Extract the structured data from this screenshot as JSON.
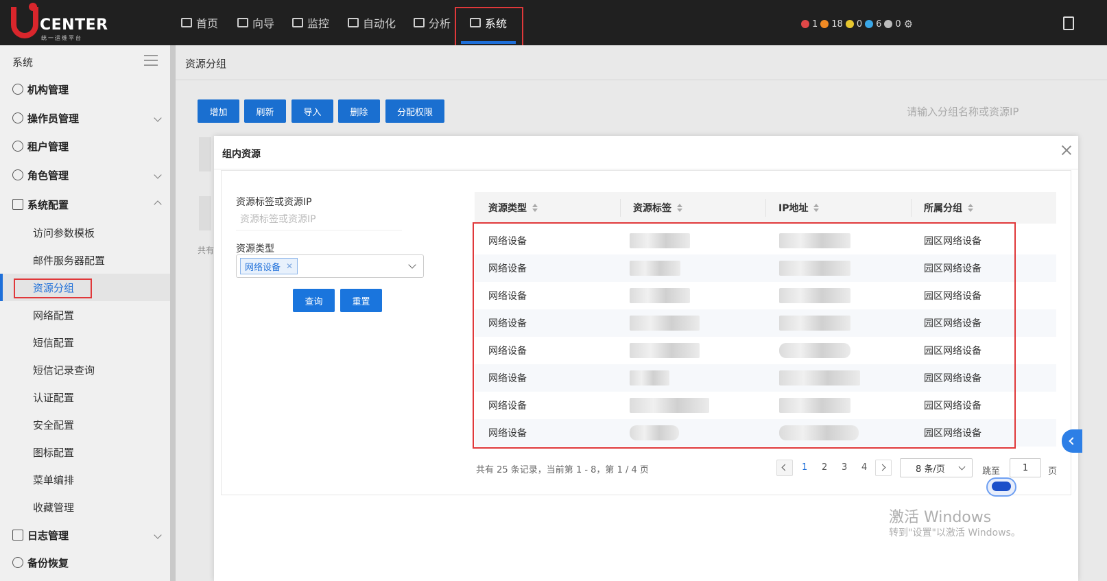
{
  "app": {
    "logo_title": "CENTER",
    "logo_sub": "统一运维平台"
  },
  "topnav": {
    "items": [
      {
        "label": "首页",
        "icon": "home-icon"
      },
      {
        "label": "向导",
        "icon": "guide-icon"
      },
      {
        "label": "监控",
        "icon": "monitor-icon"
      },
      {
        "label": "自动化",
        "icon": "automation-icon"
      },
      {
        "label": "分析",
        "icon": "analysis-icon"
      },
      {
        "label": "系统",
        "icon": "system-icon"
      }
    ],
    "active_index": 5,
    "alerts": [
      {
        "count": "1",
        "color": "#e04848"
      },
      {
        "count": "18",
        "color": "#f08a24"
      },
      {
        "count": "0",
        "color": "#e6c62f"
      },
      {
        "count": "6",
        "color": "#3aa7e8"
      },
      {
        "count": "0",
        "color": "#bbbbbb"
      }
    ]
  },
  "sidebar": {
    "title": "系统",
    "groups": [
      {
        "label": "机构管理",
        "icon": "org-icon",
        "chevron": "none"
      },
      {
        "label": "操作员管理",
        "icon": "operator-icon",
        "chevron": "down"
      },
      {
        "label": "租户管理",
        "icon": "tenant-icon",
        "chevron": "none"
      },
      {
        "label": "角色管理",
        "icon": "role-icon",
        "chevron": "down"
      },
      {
        "label": "系统配置",
        "icon": "config-icon",
        "chevron": "up"
      }
    ],
    "sub_items": [
      "访问参数模板",
      "邮件服务器配置",
      "资源分组",
      "网络配置",
      "短信配置",
      "短信记录查询",
      "认证配置",
      "安全配置",
      "图标配置",
      "菜单编排",
      "收藏管理"
    ],
    "active_sub": "资源分组",
    "bottom_groups": [
      {
        "label": "日志管理",
        "icon": "log-icon",
        "chevron": "down"
      },
      {
        "label": "备份恢复",
        "icon": "backup-icon",
        "chevron": "none"
      }
    ]
  },
  "main": {
    "title": "资源分组",
    "buttons": [
      "增加",
      "刷新",
      "导入",
      "删除",
      "分配权限"
    ],
    "search_placeholder": "请输入分组名称或资源IP",
    "total_partial": "共有"
  },
  "modal": {
    "title": "组内资源",
    "filter": {
      "label1": "资源标签或资源IP",
      "placeholder1": "资源标签或资源IP",
      "label2": "资源类型",
      "selected_tag": "网络设备",
      "query_label": "查询",
      "reset_label": "重置"
    },
    "table": {
      "columns": [
        "资源类型",
        "资源标签",
        "IP地址",
        "所属分组"
      ],
      "rows": [
        {
          "type": "网络设备",
          "group": "园区网络设备"
        },
        {
          "type": "网络设备",
          "group": "园区网络设备"
        },
        {
          "type": "网络设备",
          "group": "园区网络设备"
        },
        {
          "type": "网络设备",
          "group": "园区网络设备"
        },
        {
          "type": "网络设备",
          "group": "园区网络设备"
        },
        {
          "type": "网络设备",
          "group": "园区网络设备"
        },
        {
          "type": "网络设备",
          "group": "园区网络设备"
        },
        {
          "type": "网络设备",
          "group": "园区网络设备"
        }
      ]
    },
    "pagination": {
      "info": "共有 25 条记录，当前第 1 - 8，第 1 / 4 页",
      "pages": [
        "1",
        "2",
        "3",
        "4"
      ],
      "current": "1",
      "page_size": "8 条/页",
      "jump_label": "跳至",
      "jump_value": "1",
      "page_suffix": "页"
    }
  },
  "watermark": {
    "line1": "激活 Windows",
    "line2": "转到\"设置\"以激活 Windows。"
  }
}
